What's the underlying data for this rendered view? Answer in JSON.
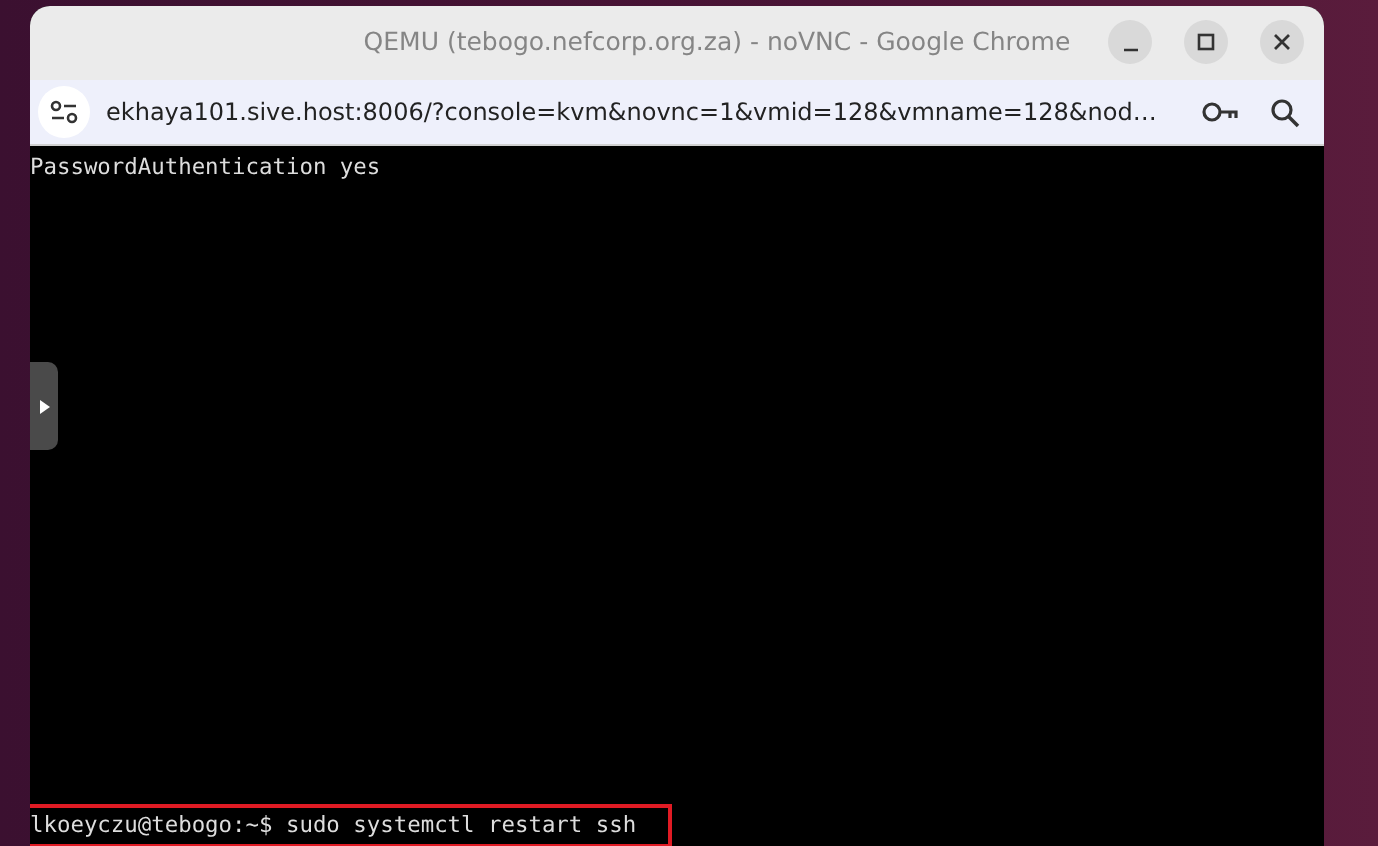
{
  "window": {
    "title": "QEMU (tebogo.nefcorp.org.za) - noVNC - Google Chrome"
  },
  "address_bar": {
    "url": "ekhaya101.sive.host:8006/?console=kvm&novnc=1&vmid=128&vmname=128&nod…"
  },
  "terminal": {
    "lines": [
      {
        "text": "PasswordAuthentication yes",
        "highlighted": false
      },
      {
        "text": "lkoeyczu@tebogo:~$ sudo systemctl restart ssh",
        "highlighted": true
      }
    ]
  }
}
